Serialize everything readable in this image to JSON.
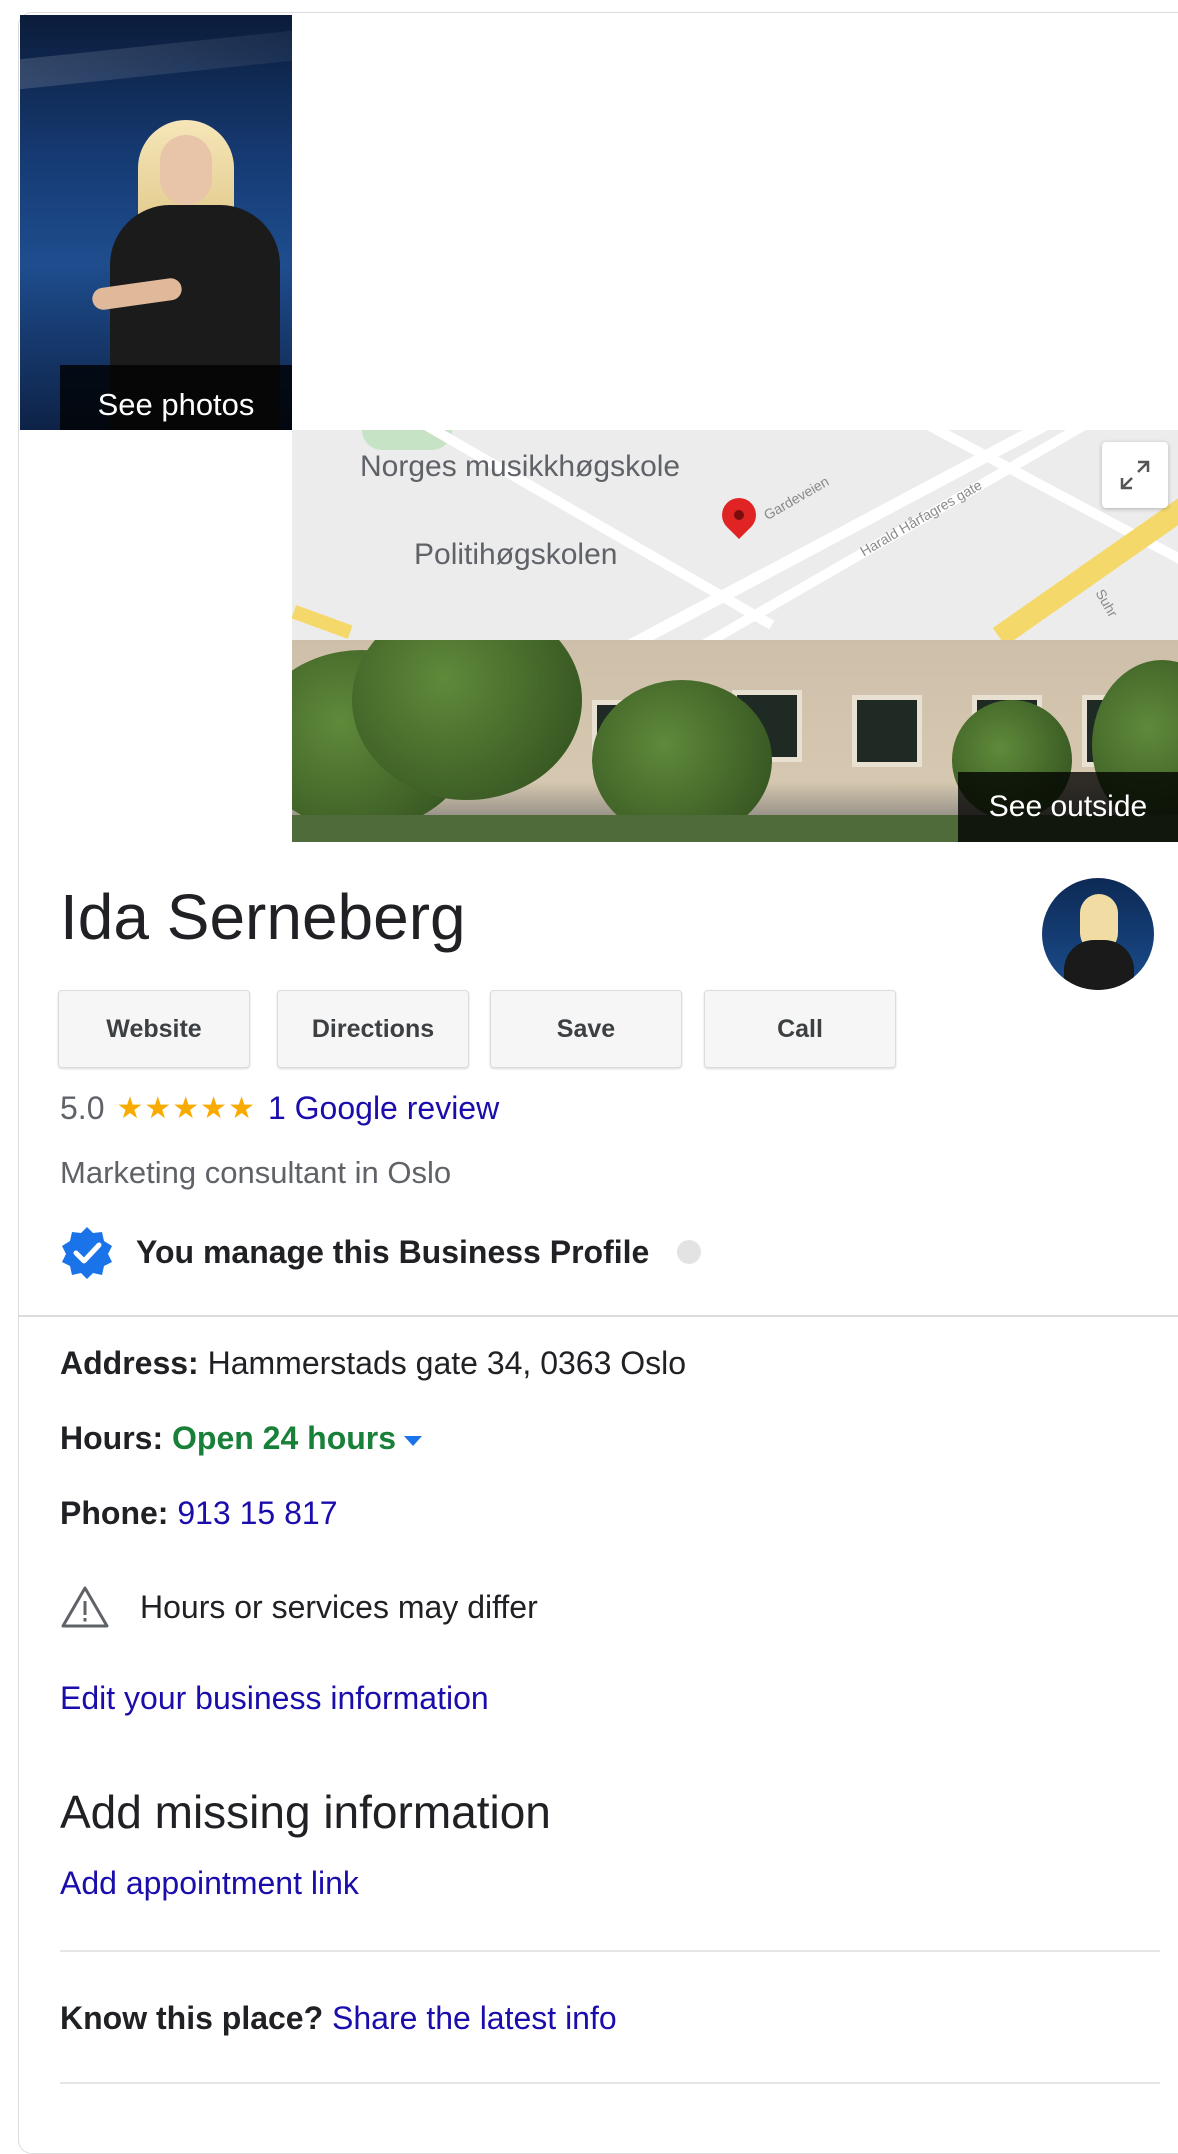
{
  "photos": {
    "see_photos_label": "See photos",
    "see_outside_label": "See outside"
  },
  "map": {
    "labels": [
      "Norges musikkhøgskole",
      "Politihøgskolen"
    ],
    "street_labels": [
      "Gardeveien",
      "Harald Hårfagres gate",
      "Suhr"
    ],
    "expand_icon": "expand-icon"
  },
  "business": {
    "name": "Ida Serneberg",
    "rating": "5.0",
    "stars": "★★★★★",
    "review_link": "1 Google review",
    "category": "Marketing consultant in Oslo",
    "manage_text": "You manage this Business Profile"
  },
  "actions": {
    "website": "Website",
    "directions": "Directions",
    "save": "Save",
    "call": "Call"
  },
  "details": {
    "address_label": "Address:",
    "address_value": "Hammerstads gate 34, 0363 Oslo",
    "hours_label": "Hours:",
    "hours_value": "Open 24 hours",
    "phone_label": "Phone:",
    "phone_value": "913 15 817",
    "warning": "Hours or services may differ",
    "edit_link": "Edit your business information"
  },
  "missing": {
    "title": "Add missing information",
    "appointment_link": "Add appointment link"
  },
  "know": {
    "question": "Know this place?",
    "share_link": "Share the latest info"
  },
  "colors": {
    "link": "#1a0dab",
    "open": "#188038",
    "star": "#f9ab00",
    "verified": "#1a73e8"
  }
}
